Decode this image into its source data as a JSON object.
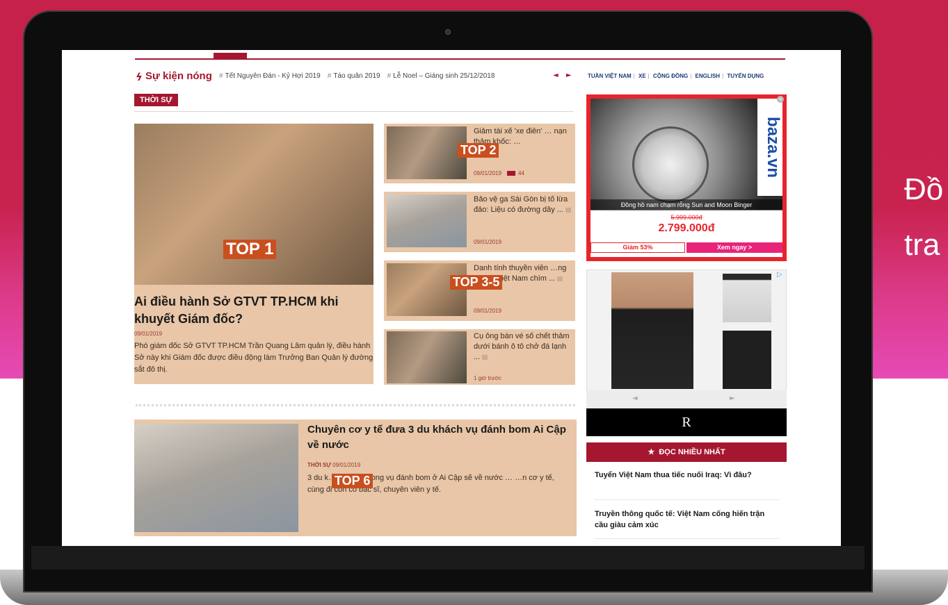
{
  "side_text": {
    "line1": "Đồ",
    "line2": "tra"
  },
  "site": {
    "hot_events": {
      "title": "Sự kiện nóng",
      "tags": [
        "Tết Nguyên Đán - Kỷ Hợi 2019",
        "Táo quân 2019",
        "Lễ Noel – Giáng sinh 25/12/2018"
      ],
      "nav_arrows": "◄ ►"
    },
    "top_links": [
      "TUẦN VIỆT NAM",
      "XE",
      "CỘNG ĐỒNG",
      "ENGLISH",
      "TUYỂN DỤNG"
    ],
    "section_label": "THỜI SỰ"
  },
  "main_story": {
    "overlay": "TOP 1",
    "title": "Ai điều hành Sở GTVT TP.HCM khi khuyết Giám đốc?",
    "date": "09/01/2019",
    "summary": "Phó giám đốc Sở GTVT TP.HCM Trần Quang Lâm quản lý, điều hành Sở này khi Giám đốc được điều động làm Trưởng Ban Quản lý đường sắt đô thị."
  },
  "side_stories": [
    {
      "overlay": "TOP 2",
      "title": "Giảm tài xế 'xe điên' … nạn thảm khốc: …",
      "date": "09/01/2019",
      "comments": "44"
    },
    {
      "overlay": "",
      "title": "Bảo vệ ga Sài Gòn bị tố lừa đảo: Liệu có đường dây ...",
      "date": "09/01/2019",
      "comments": ""
    },
    {
      "overlay": "TOP 3-5",
      "title": "Danh tính thuyền viên …ng vụ tàu Việt Nam chìm ...",
      "date": "09/01/2019",
      "comments": ""
    },
    {
      "overlay": "",
      "title": "Cụ ông bán vé số chết thảm dưới bánh ô tô chở đá lạnh ...",
      "date": "1 giờ trước",
      "comments": ""
    }
  ],
  "bottom_story": {
    "overlay": "TOP 6",
    "title": "Chuyên cơ y tế đưa 3 du khách vụ đánh bom Ai Cập về nước",
    "category": "THỜI SỰ",
    "date": "09/01/2019",
    "summary": "3 du k… …ương trong vụ đánh bom ở Ai Cập sẽ về nước … …n cơ y tế, cùng đi còn có bác sĩ, chuyên viên y tế."
  },
  "ad_watch": {
    "brand": "baza.vn",
    "caption": "Đồng hồ nam chạm rỗng Sun and Moon Binger",
    "old_price": "5.999.000đ",
    "price": "2.799.000đ",
    "discount": "Giảm 53%",
    "cta": "Xem ngay >"
  },
  "ad_fashion": {
    "logo": "R",
    "nav_prev": "◄",
    "nav_next": "►"
  },
  "most_read": {
    "header": "ĐỌC NHIỀU NHẤT",
    "items": [
      "Tuyển Việt Nam thua tiếc nuối Iraq: Vì đâu?",
      "Truyền thông quốc tế: Việt Nam cống hiến trận cầu giàu cảm xúc"
    ]
  }
}
